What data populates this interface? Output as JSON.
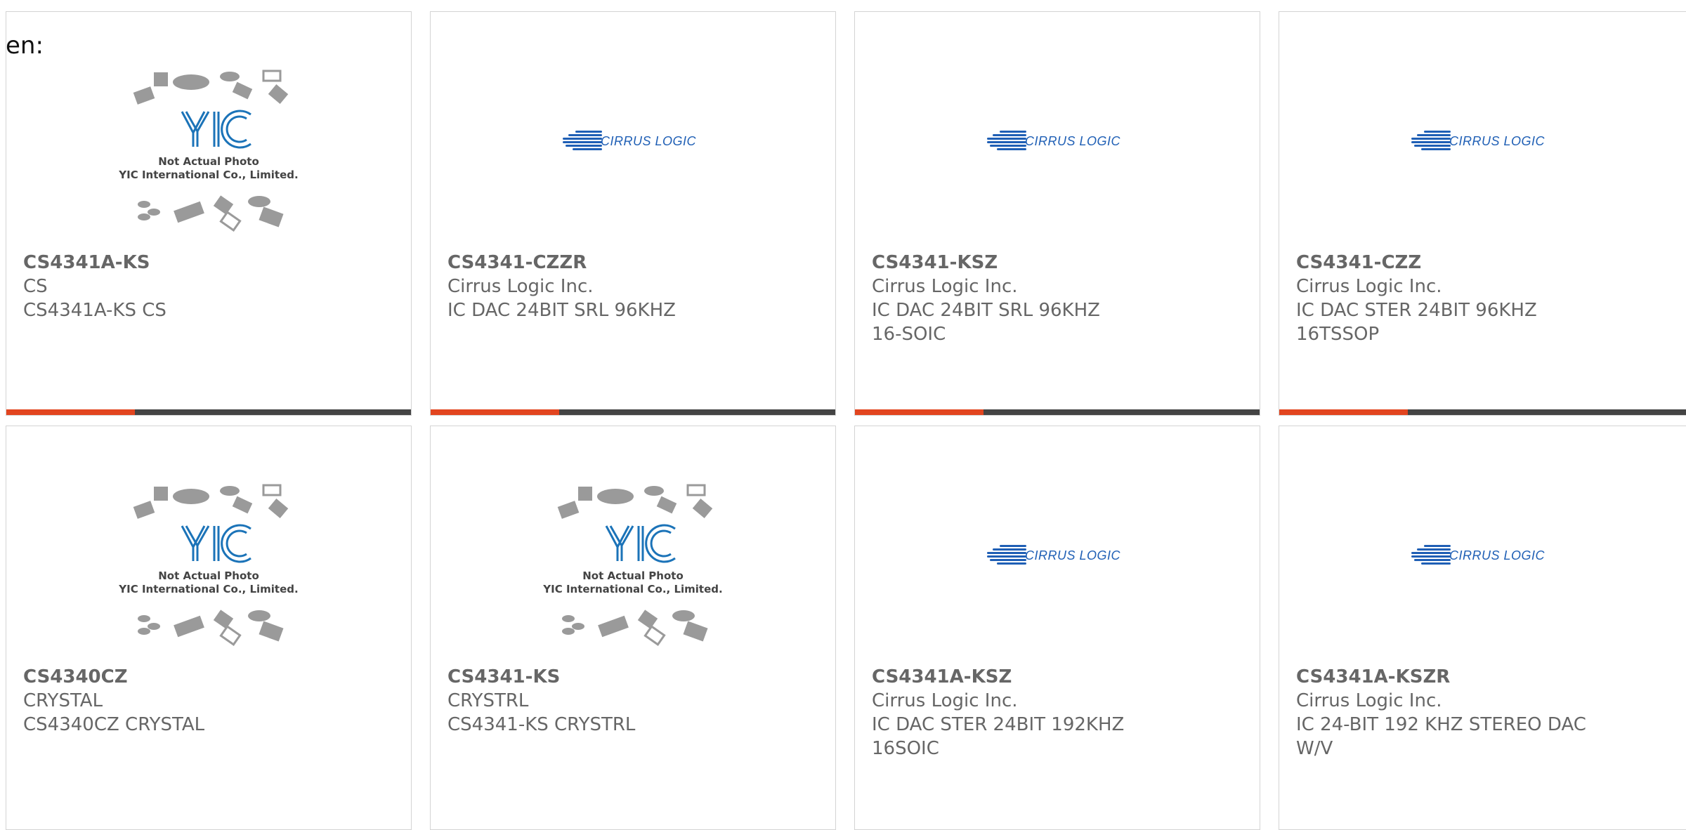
{
  "page": {
    "lang_label": "en:"
  },
  "colors": {
    "accent": "#e2451f",
    "bar": "#444444",
    "text": "#666666",
    "brand_blue": "#1f5fb5"
  },
  "placeholder": {
    "line1": "Not Actual Photo",
    "line2": "YIC International Co., Limited.",
    "logo_text": "YIC"
  },
  "cirrus_logo": {
    "text": "CIRRUS LOGIC"
  },
  "products": [
    {
      "part": "CS4341A-KS",
      "manufacturer": "CS",
      "description": "CS4341A-KS CS",
      "image": "yic-placeholder"
    },
    {
      "part": "CS4341-CZZR",
      "manufacturer": "Cirrus Logic Inc.",
      "description": "IC DAC 24BIT SRL 96KHZ",
      "image": "cirrus-logo"
    },
    {
      "part": "CS4341-KSZ",
      "manufacturer": "Cirrus Logic Inc.",
      "description": "IC DAC 24BIT SRL 96KHZ 16-SOIC",
      "image": "cirrus-logo"
    },
    {
      "part": "CS4341-CZZ",
      "manufacturer": "Cirrus Logic Inc.",
      "description": "IC DAC STER 24BIT 96KHZ 16TSSOP",
      "image": "cirrus-logo"
    },
    {
      "part": "CS4340CZ",
      "manufacturer": "CRYSTAL",
      "description": "CS4340CZ CRYSTAL",
      "image": "yic-placeholder"
    },
    {
      "part": "CS4341-KS",
      "manufacturer": "CRYSTRL",
      "description": "CS4341-KS CRYSTRL",
      "image": "yic-placeholder"
    },
    {
      "part": "CS4341A-KSZ",
      "manufacturer": "Cirrus Logic Inc.",
      "description": "IC DAC STER 24BIT 192KHZ 16SOIC",
      "image": "cirrus-logo"
    },
    {
      "part": "CS4341A-KSZR",
      "manufacturer": "Cirrus Logic Inc.",
      "description": "IC 24-BIT 192 KHZ STEREO DAC W/V",
      "image": "cirrus-logo"
    }
  ]
}
